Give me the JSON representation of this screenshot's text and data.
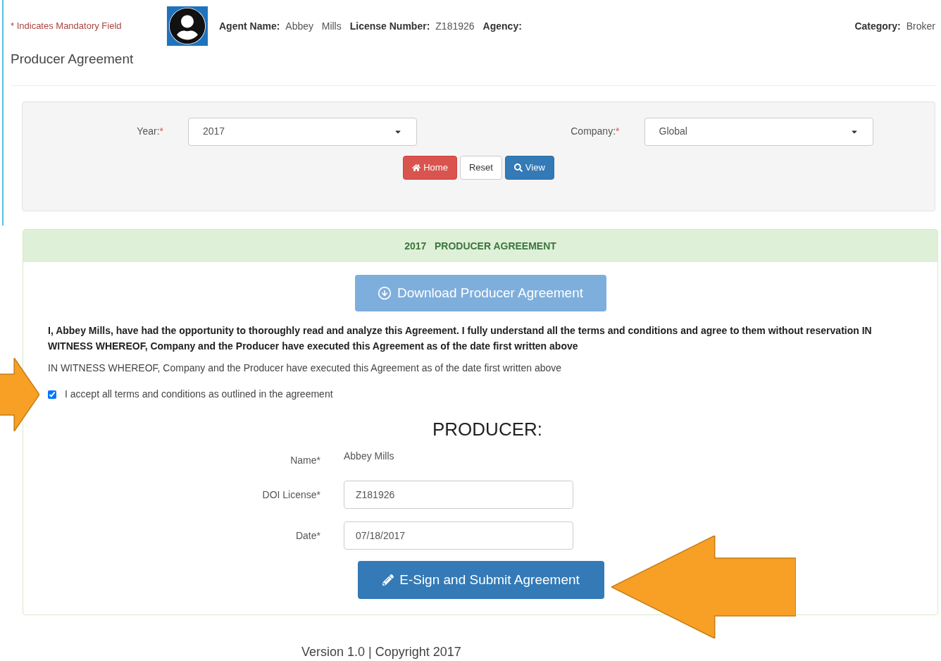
{
  "header": {
    "mandatory_note": "* Indicates Mandatory Field",
    "fields": [
      {
        "label": "Agent Name:",
        "value": "Abbey   Mills"
      },
      {
        "label": "License Number:",
        "value": "Z181926"
      },
      {
        "label": "Agency:"
      }
    ],
    "category": {
      "label": "Category:",
      "value": "Broker"
    }
  },
  "page_title": "Producer Agreement",
  "filters": [
    {
      "label": "Year:",
      "required_mark": "*",
      "value": "2017"
    },
    {
      "label": "Company:",
      "required_mark": "*",
      "value": "Global"
    }
  ],
  "filter_buttons": [
    {
      "kind": "home",
      "label": "Home"
    },
    {
      "kind": "reset",
      "label": "Reset"
    },
    {
      "kind": "view",
      "label": "View"
    }
  ],
  "agreement": {
    "title": "2017   PRODUCER AGREEMENT",
    "download_button": "Download Producer Agreement",
    "statement": "I, Abbey  Mills, have had the opportunity to thoroughly read and analyze this Agreement. I fully understand all the terms and conditions and agree to them without reservation IN WITNESS WHEREOF, Company and the Producer have executed this Agreement as of the date first written above",
    "witness": "IN WITNESS WHEREOF, Company and the Producer have executed this Agreement as of the date first written above",
    "accept": {
      "label": "I accept all terms and conditions as outlined in the agreement",
      "checked": true
    },
    "producer_heading": "PRODUCER:",
    "form": [
      {
        "kind": "text",
        "label": "Name*",
        "value": "Abbey Mills"
      },
      {
        "kind": "input",
        "label": "DOI License*",
        "value": "Z181926"
      },
      {
        "kind": "input",
        "label": "Date*",
        "value": "07/18/2017"
      }
    ],
    "submit_button": "E-Sign and Submit Agreement"
  },
  "footer": "Version 1.0 | Copyright 2017"
}
